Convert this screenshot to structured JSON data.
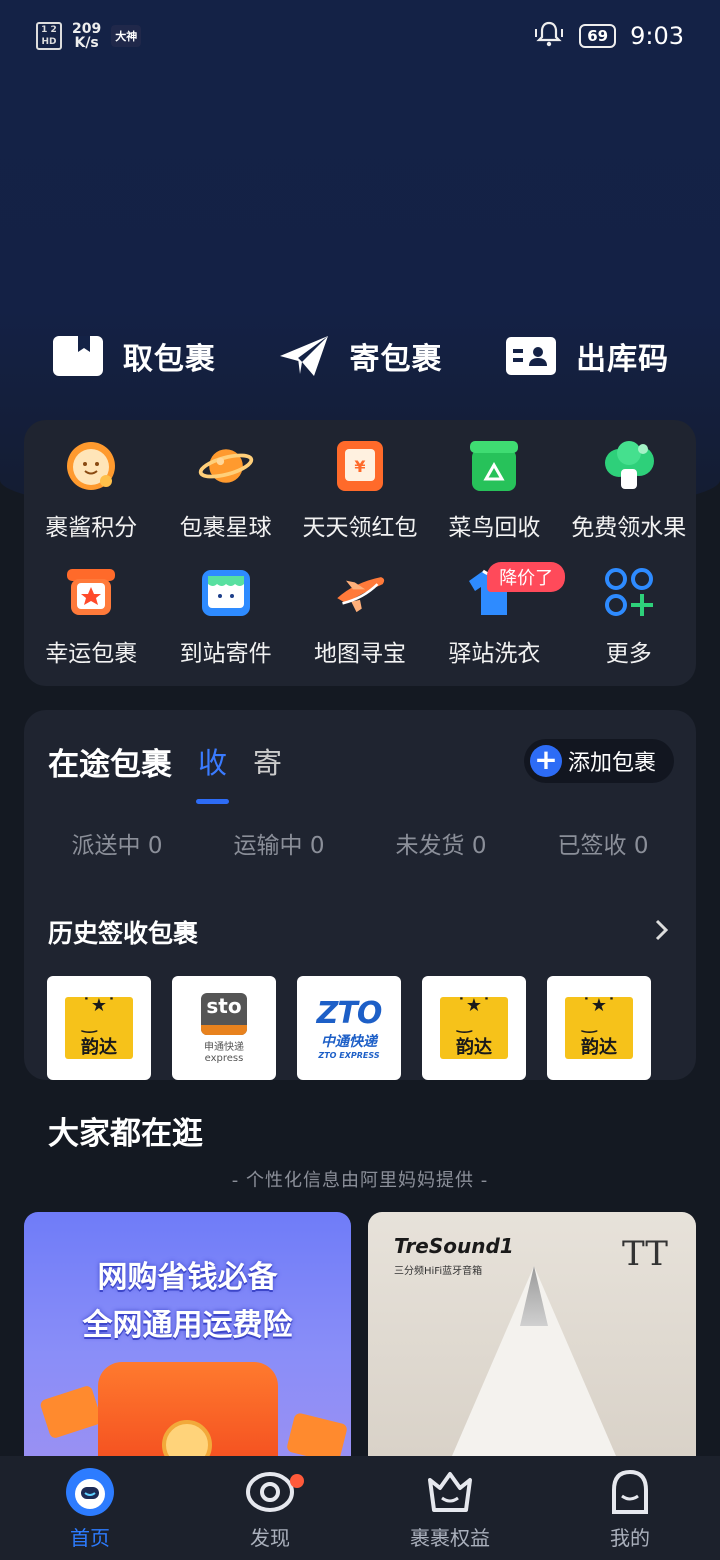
{
  "status_bar": {
    "hd": "HD",
    "network_speed_value": "209",
    "network_speed_unit": "K/s",
    "app_badge": "大神",
    "battery": "69",
    "time": "9:03"
  },
  "quick_actions": [
    {
      "label": "取包裹",
      "icon": "package-icon"
    },
    {
      "label": "寄包裹",
      "icon": "paper-plane-icon"
    },
    {
      "label": "出库码",
      "icon": "id-card-icon"
    }
  ],
  "services": [
    {
      "label": "裹酱积分",
      "icon": "points-mascot-icon"
    },
    {
      "label": "包裹星球",
      "icon": "planet-icon"
    },
    {
      "label": "天天领红包",
      "icon": "red-packet-icon"
    },
    {
      "label": "菜鸟回收",
      "icon": "recycle-icon"
    },
    {
      "label": "免费领水果",
      "icon": "fruit-tree-icon"
    },
    {
      "label": "幸运包裹",
      "icon": "lucky-box-icon"
    },
    {
      "label": "到站寄件",
      "icon": "station-send-icon"
    },
    {
      "label": "地图寻宝",
      "icon": "airplane-map-icon"
    },
    {
      "label": "驿站洗衣",
      "icon": "laundry-shirt-icon",
      "badge": "降价了"
    },
    {
      "label": "更多",
      "icon": "more-grid-icon"
    }
  ],
  "transit": {
    "title": "在途包裹",
    "tabs": [
      "收",
      "寄"
    ],
    "active_tab": "收",
    "add_label": "添加包裹",
    "statuses": [
      "派送中 0",
      "运输中 0",
      "未发货 0",
      "已签收 0"
    ],
    "history_title": "历史签收包裹",
    "couriers": [
      {
        "name": "韵达",
        "type": "yunda"
      },
      {
        "name": "sto",
        "type": "sto",
        "cn": "申通快递",
        "en": "express"
      },
      {
        "name": "ZTO",
        "type": "zto",
        "cn": "中通快递",
        "en": "ZTO EXPRESS"
      },
      {
        "name": "韵达",
        "type": "yunda"
      },
      {
        "name": "韵达",
        "type": "yunda"
      }
    ]
  },
  "browse": {
    "title": "大家都在逛",
    "subtitle": "- 个性化信息由阿里妈妈提供 -",
    "promo_line1": "网购省钱必备",
    "promo_line2": "全网通用运费险",
    "product_brand": "TreSound1",
    "product_desc": "三分频HiFi蓝牙音箱",
    "product_logo": "TT"
  },
  "tabbar": [
    {
      "label": "首页",
      "active": true
    },
    {
      "label": "发现",
      "active": false,
      "dot": true
    },
    {
      "label": "裹裹权益",
      "active": false
    },
    {
      "label": "我的",
      "active": false
    }
  ],
  "colors": {
    "accent": "#2d6cf6",
    "badge_red": "#ff4a5a",
    "yunda_yellow": "#f6c21a"
  }
}
